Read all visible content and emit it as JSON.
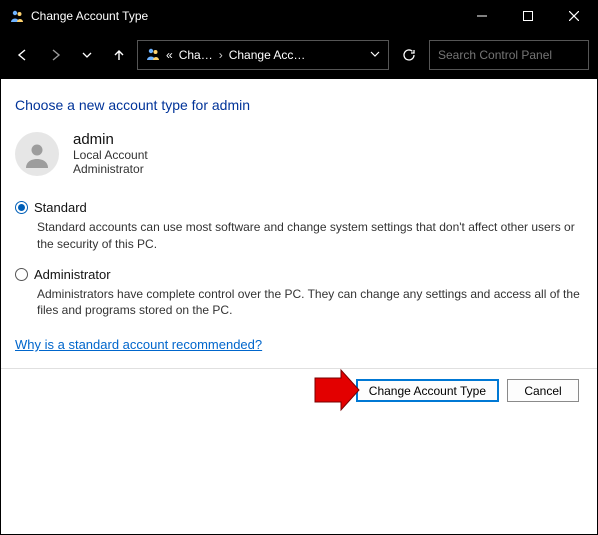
{
  "window": {
    "title": "Change Account Type"
  },
  "nav": {
    "breadcrumb_prefix": "«",
    "crumb1": "Cha…",
    "crumb2": "Change Acc…",
    "search_placeholder": "Search Control Panel"
  },
  "page": {
    "heading": "Choose a new account type for admin"
  },
  "user": {
    "name": "admin",
    "line1": "Local Account",
    "line2": "Administrator"
  },
  "options": {
    "standard": {
      "label": "Standard",
      "desc": "Standard accounts can use most software and change system settings that don't affect other users or the security of this PC.",
      "selected": true
    },
    "administrator": {
      "label": "Administrator",
      "desc": "Administrators have complete control over the PC. They can change any settings and access all of the files and programs stored on the PC.",
      "selected": false
    }
  },
  "help_link": "Why is a standard account recommended?",
  "buttons": {
    "primary": "Change Account Type",
    "cancel": "Cancel"
  }
}
